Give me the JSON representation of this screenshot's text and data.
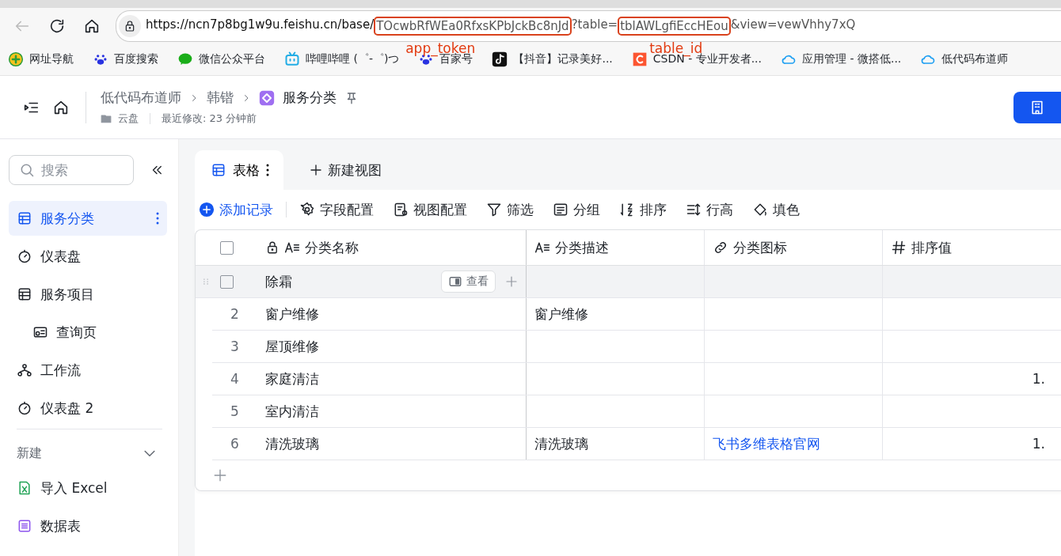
{
  "browser": {
    "url_segments": [
      {
        "text": "https://ncn7p8bg1w9u.feishu.cn/base/",
        "highlighted": false
      },
      {
        "text": "TOcwbRfWEa0RfxsKPbJckBc8nJd",
        "highlighted": true,
        "annotation": "app_token"
      },
      {
        "text": "?table=",
        "highlighted": false
      },
      {
        "text": "tblAWLgfiEccHEou",
        "highlighted": true,
        "annotation": "table_id"
      },
      {
        "text": "&view=vewVhhy7xQ",
        "highlighted": false
      }
    ],
    "bookmarks": [
      {
        "label": "网址导航",
        "kind": "nav"
      },
      {
        "label": "百度搜索",
        "kind": "paw"
      },
      {
        "label": "微信公众平台",
        "kind": "chat"
      },
      {
        "label": "哔哩哔哩 (゜-゜)つ",
        "kind": "tv"
      },
      {
        "label": "百家号",
        "kind": "paw"
      },
      {
        "label": "【抖音】记录美好...",
        "kind": "note"
      },
      {
        "label": "CSDN - 专业开发者...",
        "kind": "c"
      },
      {
        "label": "应用管理 - 微搭低...",
        "kind": "cloud"
      },
      {
        "label": "低代码布道师",
        "kind": "cloud"
      }
    ]
  },
  "header": {
    "breadcrumbs": [
      "低代码布道师",
      "韩锴",
      "服务分类"
    ],
    "location": "云盘",
    "modified": "最近修改: 23 分钟前"
  },
  "sidebar": {
    "search": {
      "placeholder": "搜索"
    },
    "items": [
      {
        "label": "服务分类",
        "kind": "table",
        "selected": true
      },
      {
        "label": "仪表盘",
        "kind": "dashboard",
        "selected": false
      },
      {
        "label": "服务项目",
        "kind": "table",
        "selected": false,
        "children": [
          {
            "label": "查询页",
            "kind": "form",
            "selected": false
          }
        ]
      },
      {
        "label": "工作流",
        "kind": "flow",
        "selected": false
      },
      {
        "label": "仪表盘 2",
        "kind": "dashboard",
        "selected": false
      }
    ],
    "new_section": {
      "label": "新建",
      "expanded": true,
      "items": [
        {
          "label": "导入 Excel",
          "kind": "excel"
        },
        {
          "label": "数据表",
          "kind": "sheet"
        }
      ]
    }
  },
  "views": {
    "tabs": [
      {
        "label": "表格",
        "selected": true
      }
    ],
    "new_view": "新建视图"
  },
  "toolbar": [
    {
      "label": "添加记录",
      "kind": "add"
    },
    {
      "label": "字段配置",
      "kind": "gear"
    },
    {
      "label": "视图配置",
      "kind": "view"
    },
    {
      "label": "筛选",
      "kind": "filter"
    },
    {
      "label": "分组",
      "kind": "group"
    },
    {
      "label": "排序",
      "kind": "sort"
    },
    {
      "label": "行高",
      "kind": "height"
    },
    {
      "label": "填色",
      "kind": "fill"
    }
  ],
  "table": {
    "select_all_checked": false,
    "columns": [
      {
        "label": "分类名称",
        "kind": "text",
        "locked": true
      },
      {
        "label": "分类描述",
        "kind": "text",
        "locked": false
      },
      {
        "label": "分类图标",
        "kind": "link",
        "locked": false
      },
      {
        "label": "排序值",
        "kind": "number",
        "locked": false
      }
    ],
    "rows": [
      {
        "hovered": true,
        "checked": false,
        "view_button": "查看",
        "cells": [
          "除霜",
          "",
          "",
          ""
        ]
      },
      {
        "hovered": false,
        "number": "2",
        "cells": [
          "窗户维修",
          "窗户维修",
          "",
          ""
        ]
      },
      {
        "hovered": false,
        "number": "3",
        "cells": [
          "屋顶维修",
          "",
          "",
          ""
        ]
      },
      {
        "hovered": false,
        "number": "4",
        "cells": [
          "家庭清洁",
          "",
          "",
          "1."
        ]
      },
      {
        "hovered": false,
        "number": "5",
        "cells": [
          "室内清洁",
          "",
          "",
          ""
        ]
      },
      {
        "hovered": false,
        "number": "6",
        "cells": [
          "清洗玻璃",
          "清洗玻璃",
          "飞书多维表格官网",
          "1."
        ]
      }
    ]
  }
}
